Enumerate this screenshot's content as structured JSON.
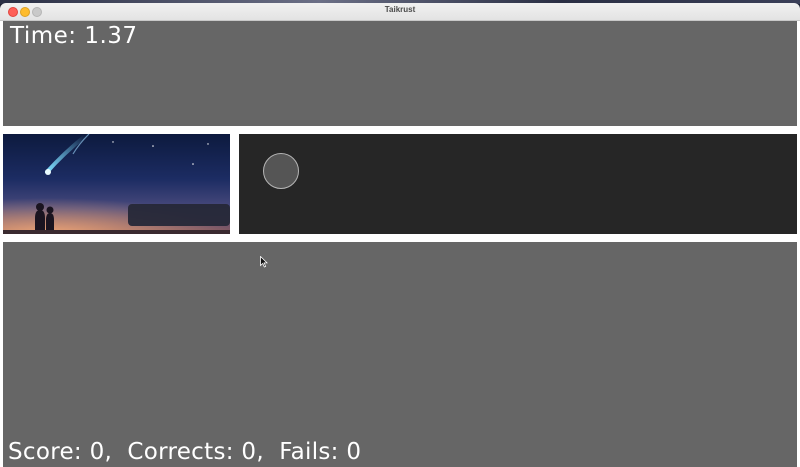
{
  "window": {
    "title": "Taikrust"
  },
  "hud": {
    "time_label": "Time:",
    "time_value": "1.37",
    "score_label": "Score:",
    "score_value": "0",
    "corrects_label": "Corrects:",
    "corrects_value": "0",
    "fails_label": "Fails:",
    "fails_value": "0"
  },
  "colors": {
    "panel_gray": "#666666",
    "drum_lane": "#262626",
    "hit_circle_fill": "#555555",
    "hit_circle_ring": "#b5b5b5",
    "divider": "#ffffff",
    "text": "#ffffff"
  },
  "icons": {
    "close": "close-dot-icon",
    "minimize": "minimize-dot-icon",
    "maximize": "maximize-dot-icon",
    "cursor": "mouse-pointer-icon"
  }
}
